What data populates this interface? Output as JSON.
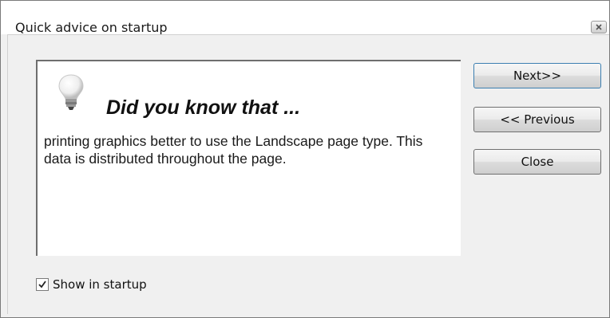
{
  "window": {
    "title": "Quick advice on startup",
    "close_icon": "close-icon"
  },
  "tip": {
    "icon": "lightbulb-icon",
    "heading": "Did you know that ...",
    "text": "printing graphics better to use the Landscape page type. This data is distributed throughout the page."
  },
  "buttons": {
    "next_label": "Next>>",
    "previous_label": "<< Previous",
    "close_label": "Close"
  },
  "startup_option": {
    "label": "Show in startup",
    "checked": true
  }
}
